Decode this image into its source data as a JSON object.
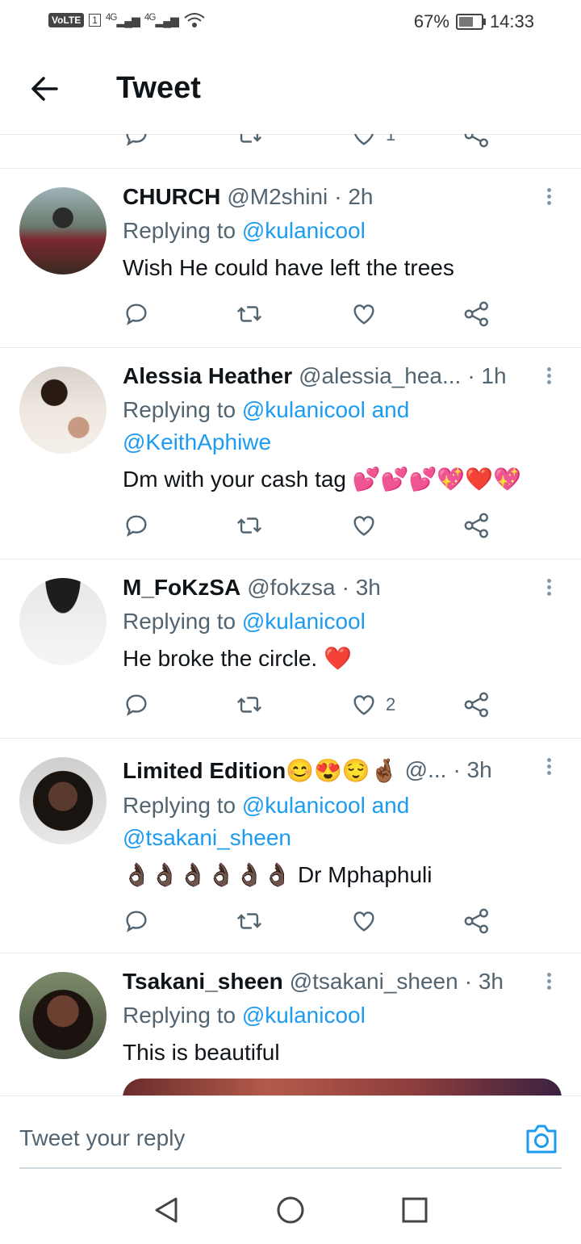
{
  "status": {
    "volte": "VoLTE",
    "sim": "1",
    "signal1": "4G",
    "signal2": "4G",
    "battery": "67%",
    "battery_level": 0.67,
    "time": "14:33"
  },
  "header": {
    "title": "Tweet"
  },
  "tweets": [
    {
      "name": "CHURCH",
      "handle": "@M2shini",
      "time": "· 2h",
      "replying": "Replying to ",
      "mentions": "@kulanicool",
      "mentions2": "",
      "text": "Wish He could have left the trees",
      "likes": ""
    },
    {
      "name": "Alessia Heather",
      "handle": "@alessia_hea...",
      "time": "· 1h",
      "replying": "Replying to ",
      "mentions": "@kulanicool and",
      "mentions2": "@KeithAphiwe",
      "text": "Dm with your cash tag 💕💕💕💖❤️💖",
      "likes": ""
    },
    {
      "name": "M_FoKzSA",
      "handle": "@fokzsa",
      "time": "· 3h",
      "replying": "Replying to ",
      "mentions": "@kulanicool",
      "mentions2": "",
      "text": "He broke the circle. ❤️",
      "likes": "2"
    },
    {
      "name": "Limited Edition😊😍😌🤞🏾",
      "handle": "@...",
      "time": "· 3h",
      "replying": "Replying to ",
      "mentions": "@kulanicool and",
      "mentions2": "@tsakani_sheen",
      "text": "👌🏿👌🏿👌🏿👌🏿👌🏿👌🏿 Dr Mphaphuli",
      "likes": ""
    },
    {
      "name": "Tsakani_sheen",
      "handle": "@tsakani_sheen",
      "time": "· 3h",
      "replying": "Replying to ",
      "mentions": "@kulanicool",
      "mentions2": "",
      "text": "This is beautiful",
      "likes": ""
    }
  ],
  "partial": {
    "likes": "1"
  },
  "reply": {
    "placeholder": "Tweet your reply"
  },
  "icons": [
    "back-arrow-icon",
    "reply-icon",
    "retweet-icon",
    "like-icon",
    "share-icon",
    "more-icon",
    "camera-icon",
    "nav-back-icon",
    "nav-home-icon",
    "nav-recents-icon"
  ]
}
